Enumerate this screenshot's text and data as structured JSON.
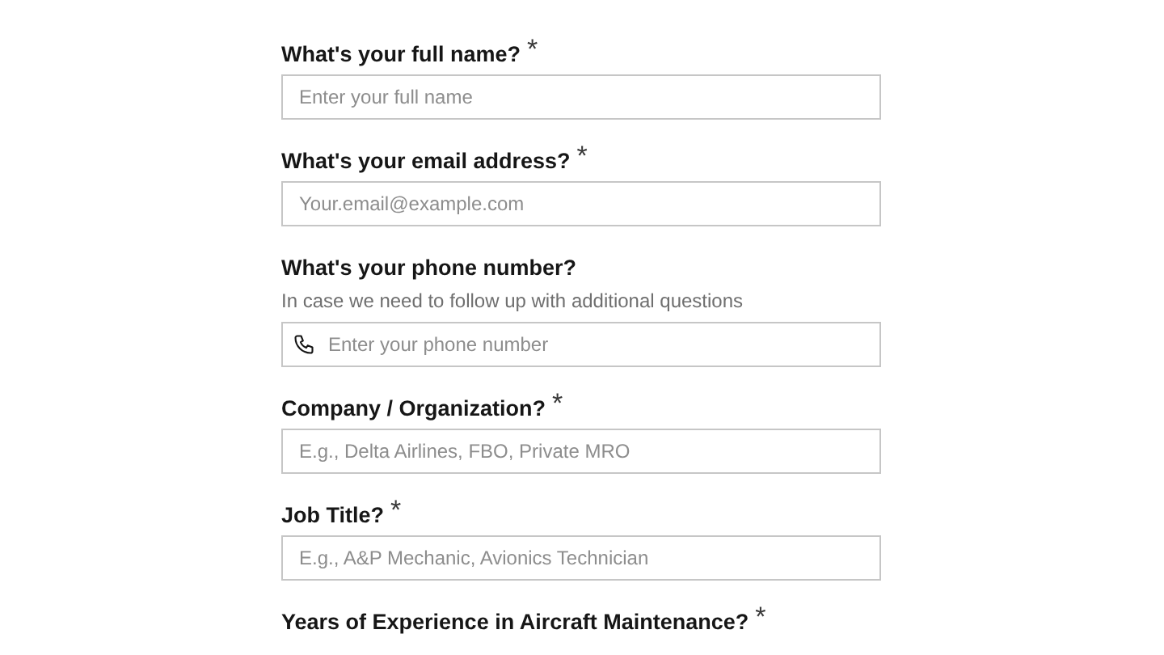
{
  "fields": [
    {
      "label": "What's your full name?",
      "asterisk": "*",
      "placeholder": "Enter your full name",
      "kind": "text"
    },
    {
      "label": "What's your email address?",
      "asterisk": "*",
      "placeholder": "Your.email@example.com",
      "kind": "text"
    },
    {
      "label": "What's your phone number?",
      "hint": "In case we need to follow up with additional questions",
      "placeholder": "Enter your phone number",
      "kind": "phone"
    },
    {
      "label": "Company / Organization?",
      "asterisk": "*",
      "placeholder": "E.g., Delta Airlines, FBO, Private MRO",
      "kind": "text"
    },
    {
      "label": "Job Title?",
      "asterisk": "*",
      "placeholder": "E.g., A&P Mechanic, Avionics Technician",
      "kind": "text"
    },
    {
      "label": "Years of Experience in Aircraft Maintenance?",
      "asterisk": "*",
      "kind": "none"
    }
  ]
}
